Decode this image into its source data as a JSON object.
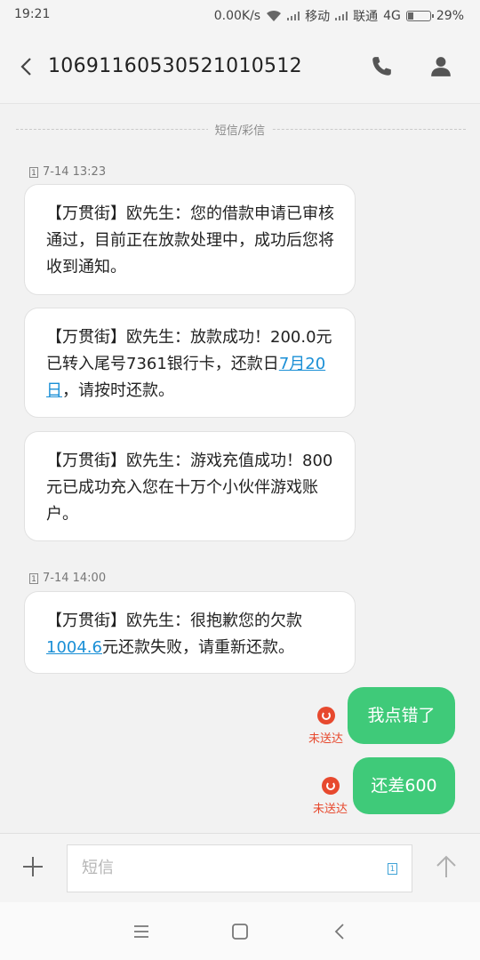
{
  "status_bar": {
    "time": "19:21",
    "speed": "0.00K/s",
    "carrier1": "移动",
    "carrier2": "联通",
    "network": "4G",
    "battery": "29%",
    "battery_level": 0.29
  },
  "header": {
    "title": "106911605305210105 12",
    "title_exact": "1069116053052101051 2",
    "phone_icon": "phone-icon",
    "contact_icon": "person-icon"
  },
  "divider": {
    "label": "短信/彩信"
  },
  "messages": [
    {
      "timestamp": "7-14 13:23"
    },
    {
      "text_pre": "【万贯街】欧先生：您的借款申请已审核通过，目前正在放款处理中，成功后您将收到通知。"
    },
    {
      "text_pre": "【万贯街】欧先生：放款成功！200.0元已转入尾号7361银行卡，还款日",
      "link": "7月20日",
      "text_post": "，请按时还款。"
    },
    {
      "text_pre": "【万贯街】欧先生：游戏充值成功！800元已成功充入您在十万个小伙伴游戏账户。"
    },
    {
      "timestamp": "7-14 14:00"
    },
    {
      "text_pre": "【万贯街】欧先生：很抱歉您的欠款",
      "link": "1004.6",
      "text_post": "元还款失败，请重新还款。"
    }
  ],
  "outgoing": [
    {
      "text": "我点错了",
      "status": "未送达"
    },
    {
      "text": "还差600",
      "status": "未送达"
    }
  ],
  "input": {
    "placeholder": "短信",
    "sim": "1"
  },
  "sim_badge": "1",
  "colors": {
    "outgoing_bubble": "#3fca79",
    "link": "#1a8fd6",
    "error": "#e7492e"
  }
}
